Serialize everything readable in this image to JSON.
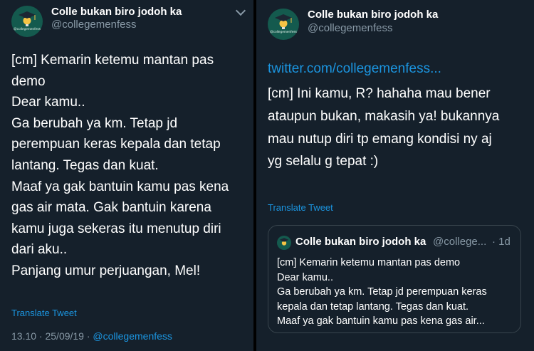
{
  "colors": {
    "background": "#15202b",
    "link": "#1b95e0",
    "muted": "#8899a6",
    "border": "#38444d"
  },
  "left_tweet": {
    "account": {
      "name": "Colle bukan biro jodoh ka",
      "handle": "@collegemenfess",
      "avatar_text": "@collegemenfess",
      "avatar_icon": "graduation-cap-lightbulb-icon"
    },
    "lines": [
      "[cm] Kemarin ketemu mantan pas",
      "demo",
      "Dear kamu..",
      "Ga berubah ya km. Tetap jd",
      "perempuan keras kepala dan tetap",
      "lantang. Tegas dan kuat.",
      "Maaf ya gak bantuin kamu pas kena",
      "gas air mata. Gak bantuin karena",
      "kamu juga sekeras itu menutup diri",
      "dari aku..",
      "Panjang umur perjuangan, Mel!"
    ],
    "translate_label": "Translate Tweet",
    "timestamp": "13.10 · 25/09/19 · ",
    "via_mention": "@collegemenfess"
  },
  "right_tweet": {
    "account": {
      "name": "Colle bukan biro jodoh ka",
      "handle": "@collegemenfess",
      "avatar_text": "@collegemenfess",
      "avatar_icon": "graduation-cap-lightbulb-icon"
    },
    "link": "twitter.com/collegemenfess...",
    "lines": [
      "[cm] Ini kamu, R? hahaha mau bener",
      "ataupun bukan, makasih ya! bukannya",
      "mau nutup diri tp emang kondisi ny aj",
      "yg selalu g tepat :)"
    ],
    "translate_label": "Translate Tweet",
    "quoted": {
      "name": "Colle bukan biro jodoh ka",
      "handle": "@college...",
      "time": "· 1d",
      "lines": [
        "[cm] Kemarin ketemu mantan pas demo",
        "Dear kamu..",
        "Ga berubah ya km. Tetap jd perempuan keras",
        "kepala dan tetap lantang. Tegas dan kuat.",
        "Maaf ya gak bantuin kamu pas kena gas air..."
      ]
    }
  }
}
